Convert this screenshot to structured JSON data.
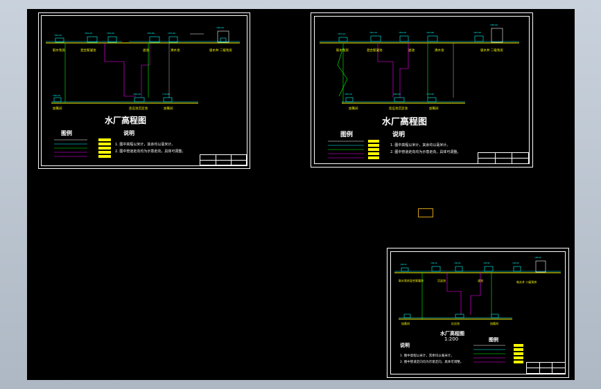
{
  "app": {
    "name": "CAD drawing viewer"
  },
  "colors": {
    "canvas": "#000000",
    "frame": "#ffffff",
    "water_line": "#ffff00",
    "pipe_green": "#00ff00",
    "pipe_cyan": "#00ffff",
    "pipe_magenta": "#ff00ff",
    "annotation": "#00ffff"
  },
  "sheets": [
    {
      "id": "sheet-1",
      "title": "水厂高程图",
      "legend_heading": "图例",
      "notes_heading": "说明",
      "notes": [
        "1. 图中高程以米计，其余均以毫米计。",
        "2. 图中管道走向均为示意走向，具体可调整。"
      ],
      "units": [
        "取水泵房",
        "混合絮凝池",
        "滤池",
        "清水池",
        "二级泵房",
        "沉淀池",
        "加氯间",
        "反应池",
        "吸水井"
      ]
    },
    {
      "id": "sheet-2",
      "title": "水厂高程图",
      "legend_heading": "图例",
      "notes_heading": "说明",
      "notes": [
        "1. 图中高程以米计，其余均以毫米计。",
        "2. 图中管道走向均为示意走向，具体可调整。"
      ],
      "units": [
        "取水泵房",
        "混合絮凝池",
        "滤池",
        "清水池",
        "二级泵房",
        "沉淀池",
        "加氯间",
        "反应池",
        "吸水井"
      ]
    },
    {
      "id": "sheet-3",
      "title": "水厂高程图",
      "scale": "1:200",
      "legend_heading": "图例",
      "notes_heading": "说明",
      "notes": [
        "1. 图中高程以米计，其余均以毫米计。",
        "2. 图中管道走向均为示意走向，具体可调整。"
      ],
      "units": [
        "取水泵房",
        "混合絮凝池",
        "滤池",
        "清水池",
        "二级泵房",
        "沉淀池",
        "加氯间",
        "反应池",
        "吸水井"
      ]
    }
  ]
}
